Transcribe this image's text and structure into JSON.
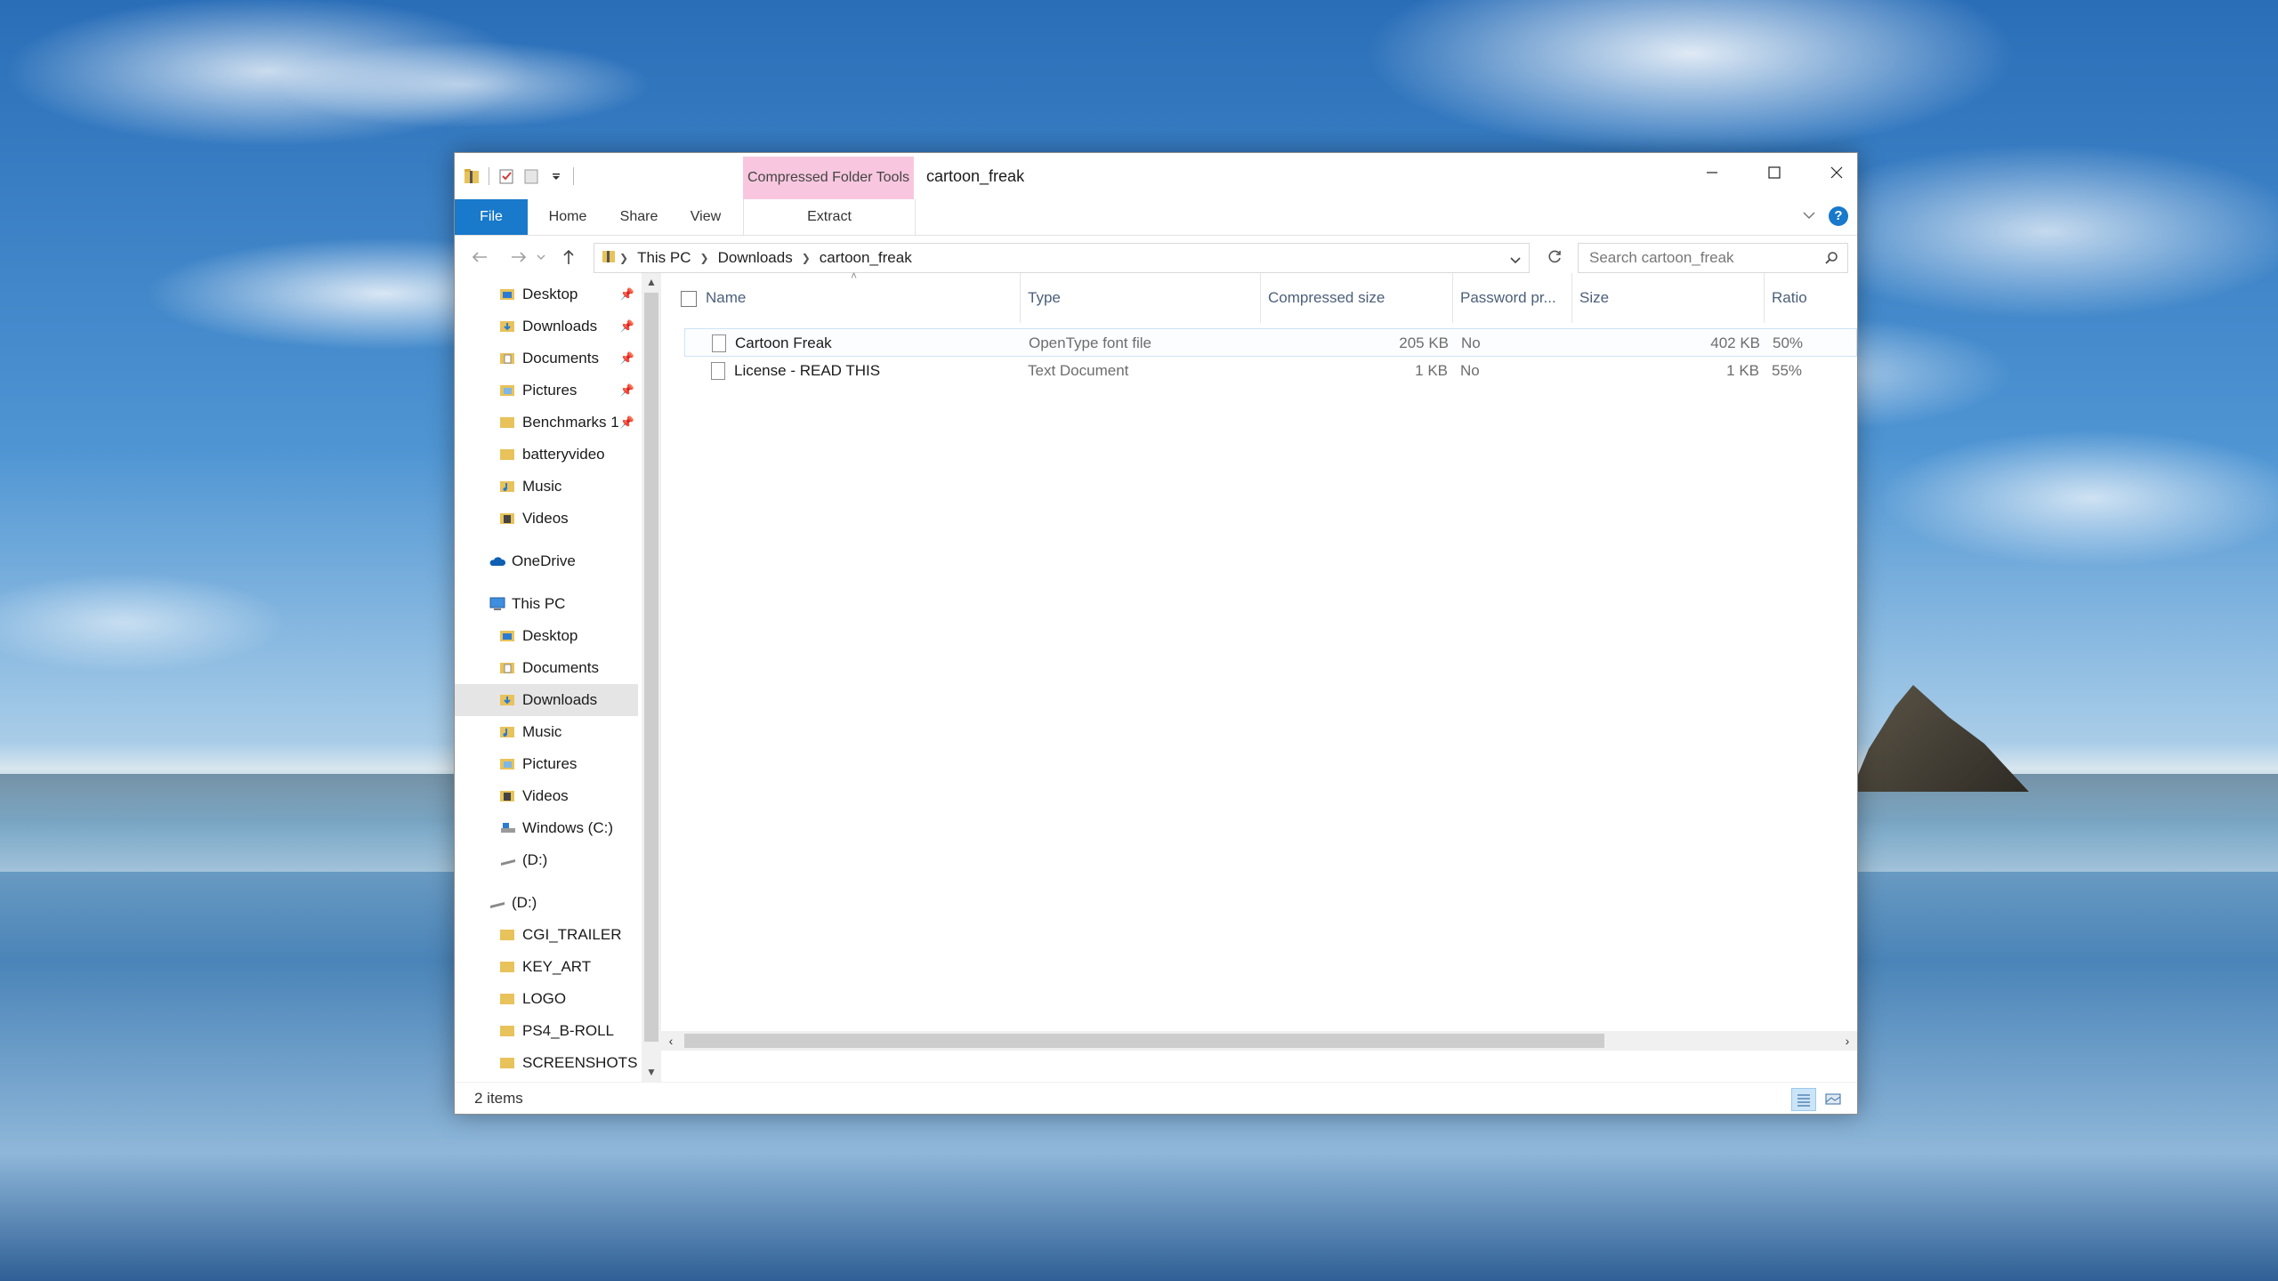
{
  "window": {
    "title": "cartoon_freak",
    "contextual_tab_group": "Compressed Folder Tools"
  },
  "ribbon": {
    "tabs": [
      "File",
      "Home",
      "Share",
      "View"
    ],
    "contextual_tab": "Extract"
  },
  "address": {
    "crumbs": [
      "This PC",
      "Downloads",
      "cartoon_freak"
    ]
  },
  "search": {
    "placeholder": "Search cartoon_freak"
  },
  "nav": {
    "quick_access": [
      {
        "label": "Desktop",
        "pinned": true
      },
      {
        "label": "Downloads",
        "pinned": true
      },
      {
        "label": "Documents",
        "pinned": true
      },
      {
        "label": "Pictures",
        "pinned": true
      },
      {
        "label": "Benchmarks 1",
        "pinned": true
      },
      {
        "label": "batteryvideo",
        "pinned": false
      },
      {
        "label": "Music",
        "pinned": false
      },
      {
        "label": "Videos",
        "pinned": false
      }
    ],
    "onedrive": "OneDrive",
    "this_pc": "This PC",
    "this_pc_items": [
      "Desktop",
      "Documents",
      "Downloads",
      "Music",
      "Pictures",
      "Videos",
      "Windows (C:)",
      "(D:)"
    ],
    "drive": "(D:)",
    "drive_items": [
      "CGI_TRAILER",
      "KEY_ART",
      "LOGO",
      "PS4_B-ROLL",
      "SCREENSHOTS"
    ],
    "selected": "Downloads"
  },
  "columns": {
    "name": "Name",
    "type": "Type",
    "compressed_size": "Compressed size",
    "password": "Password pr...",
    "size": "Size",
    "ratio": "Ratio"
  },
  "files": [
    {
      "name": "Cartoon Freak",
      "type": "OpenType font file",
      "compressed_size": "205 KB",
      "password": "No",
      "size": "402 KB",
      "ratio": "50%"
    },
    {
      "name": "License - READ THIS",
      "type": "Text Document",
      "compressed_size": "1 KB",
      "password": "No",
      "size": "1 KB",
      "ratio": "55%"
    }
  ],
  "status": {
    "item_count": "2 items"
  },
  "colors": {
    "accent": "#1979ca",
    "contextual": "#f8c7df"
  }
}
